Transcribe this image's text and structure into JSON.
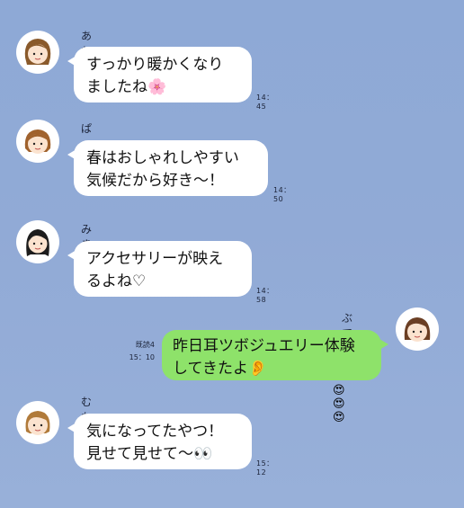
{
  "messages": [
    {
      "sender": "あむさん",
      "line1": "すっかり暖かくなり",
      "line2": "ましたね🌸",
      "time": "14：45"
    },
    {
      "sender": "ぱっさー",
      "line1": "春はおしゃれしやすい",
      "line2": "気候だから好き〜！",
      "time": "14：50"
    },
    {
      "sender": "みきゃん",
      "line1": "アクセサリーが映え",
      "line2": "るよね♡",
      "time": "14：58"
    },
    {
      "sender": "ぶてぃ",
      "line1": "昨日耳ツボジュエリー体験",
      "line2": "してきたよ👂",
      "read": "既読4",
      "time": "15：10",
      "reaction": "😍😍😍"
    },
    {
      "sender": "むたこ",
      "line1": "気になってたやつ！",
      "line2": "見せて見せて〜👀",
      "time": "15：12"
    }
  ],
  "colors": {
    "background": "#8ea9d6",
    "bubble_left": "#ffffff",
    "bubble_right": "#8ee26a"
  }
}
